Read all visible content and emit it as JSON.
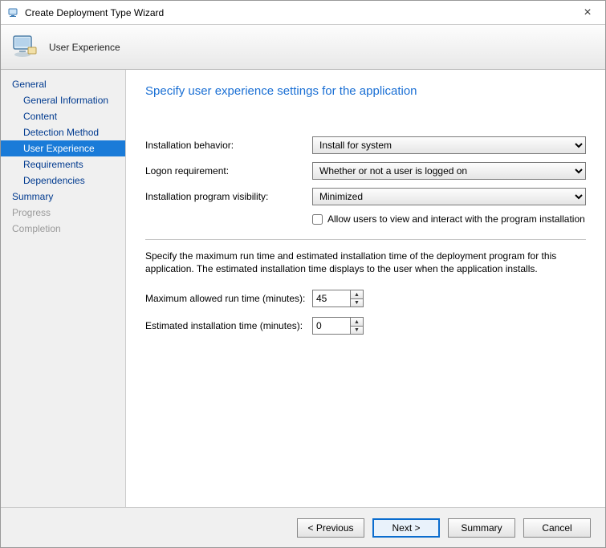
{
  "window": {
    "title": "Create Deployment Type Wizard",
    "subtitle": "User Experience"
  },
  "sidebar": {
    "items": [
      {
        "label": "General",
        "level": "top",
        "disabled": false,
        "selected": false
      },
      {
        "label": "General Information",
        "level": "child",
        "disabled": false,
        "selected": false
      },
      {
        "label": "Content",
        "level": "child",
        "disabled": false,
        "selected": false
      },
      {
        "label": "Detection Method",
        "level": "child",
        "disabled": false,
        "selected": false
      },
      {
        "label": "User Experience",
        "level": "child",
        "disabled": false,
        "selected": true
      },
      {
        "label": "Requirements",
        "level": "child",
        "disabled": false,
        "selected": false
      },
      {
        "label": "Dependencies",
        "level": "child",
        "disabled": false,
        "selected": false
      },
      {
        "label": "Summary",
        "level": "top",
        "disabled": false,
        "selected": false
      },
      {
        "label": "Progress",
        "level": "top",
        "disabled": true,
        "selected": false
      },
      {
        "label": "Completion",
        "level": "top",
        "disabled": true,
        "selected": false
      }
    ]
  },
  "page": {
    "title": "Specify user experience settings for the application",
    "installation_behavior_label": "Installation behavior:",
    "installation_behavior_value": "Install for system",
    "logon_requirement_label": "Logon requirement:",
    "logon_requirement_value": "Whether or not a user is logged on",
    "visibility_label": "Installation program visibility:",
    "visibility_value": "Minimized",
    "allow_view_label": "Allow users to view and interact with the program installation",
    "allow_view_checked": false,
    "description": "Specify the maximum run time and estimated installation time of the deployment program for this application. The estimated installation time displays to the user when the application installs.",
    "max_runtime_label": "Maximum allowed run time (minutes):",
    "max_runtime_value": "45",
    "est_install_label": "Estimated installation time (minutes):",
    "est_install_value": "0"
  },
  "footer": {
    "previous": "< Previous",
    "next": "Next >",
    "summary": "Summary",
    "cancel": "Cancel"
  }
}
